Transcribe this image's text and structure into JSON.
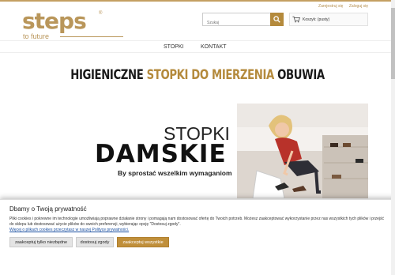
{
  "top_links": {
    "register": "Zarejestruj się",
    "login": "Zaloguj się"
  },
  "logo": {
    "word": "steps",
    "reg": "®",
    "tagline": "to future"
  },
  "search": {
    "placeholder": "Szukaj"
  },
  "cart": {
    "label": "Koszyk: (pusty)"
  },
  "nav": {
    "items": [
      "STOPKI",
      "KONTAKT"
    ]
  },
  "headline": {
    "part1": "HIGIENICZNE ",
    "part2": "STOPKI DO MIERZENIA",
    "part3": " OBUWIA"
  },
  "banner": {
    "line1": "STOPKI",
    "line2": "DAMSKIE",
    "line3": "By sprostać wszelkim wymaganiom"
  },
  "cookie": {
    "title": "Dbamy o Twoją prywatność",
    "text": "Pliki cookies i pokrewne im technologie umożliwiają poprawne działanie strony i pomagają nam dostosować ofertę do Twoich potrzeb. Możesz zaakceptować wykorzystanie przez nas wszystkich tych plików i przejść do sklepu lub dostosować użycie plików do swoich preferencji, wybierając opcję \"Dostosuj zgody\".",
    "link": "Więcej o plikach cookies przeczytasz w naszej Polityce prywatności.",
    "btn_necessary": "zaakceptuj tylko niezbędne",
    "btn_customize": "dostosuj zgody",
    "btn_all": "zaakceptuj wszystkie"
  },
  "colors": {
    "accent": "#b48a3c",
    "logo": "#b9965a",
    "link": "#1a4fa0"
  }
}
